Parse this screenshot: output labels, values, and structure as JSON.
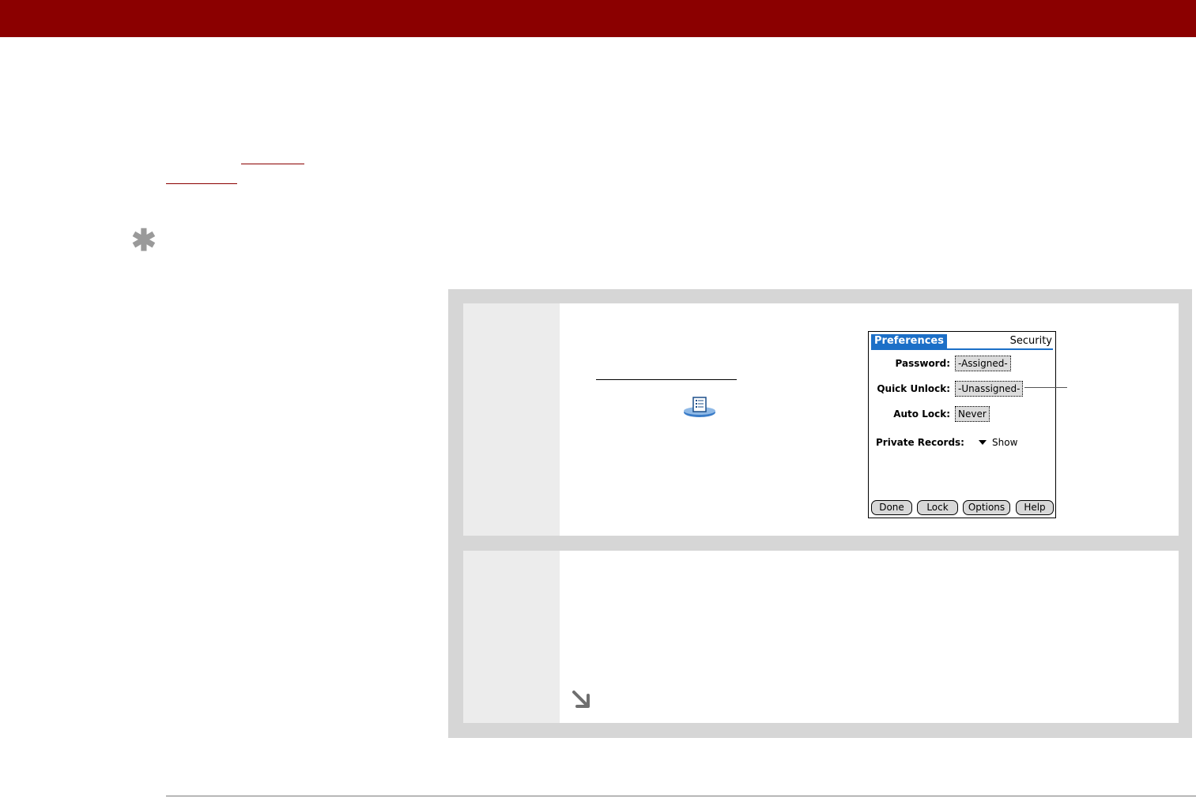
{
  "header": {
    "bar_color": "#8b0000"
  },
  "tip": {
    "icon": "asterisk-icon",
    "glyph": "✱"
  },
  "step1": {
    "icon": "app-icon",
    "screen": {
      "title": "Preferences",
      "category": "Security",
      "password_label": "Password:",
      "password_value": "-Assigned-",
      "quick_unlock_label": "Quick Unlock:",
      "quick_unlock_value": "-Unassigned-",
      "auto_lock_label": "Auto Lock:",
      "auto_lock_value": "Never",
      "private_records_label": "Private Records:",
      "private_records_value": "Show",
      "buttons": {
        "done": "Done",
        "lock": "Lock",
        "options": "Options",
        "help": "Help"
      }
    }
  },
  "step2": {
    "icon": "continue-arrow-icon",
    "glyph": "➘"
  },
  "colors": {
    "accent": "#8b0000",
    "palm_blue": "#1c6fc7",
    "panel_gray": "#d6d6d6"
  }
}
